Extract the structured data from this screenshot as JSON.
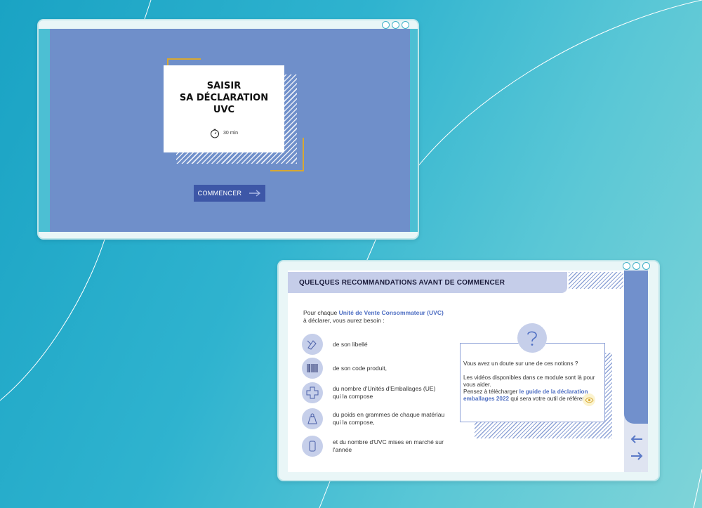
{
  "window1": {
    "title_lines": [
      "SAISIR",
      "SA DÉCLARATION",
      "UVC"
    ],
    "duration": "30 min",
    "start_label": "COMMENCER"
  },
  "window2": {
    "header": "QUELQUES RECOMMANDATIONS AVANT DE COMMENCER",
    "intro": {
      "pre": "Pour chaque ",
      "highlight": "Unité de Vente Consommateur (UVC)",
      "post": " à déclarer, vous aurez besoin :"
    },
    "items": [
      {
        "icon": "pen-tag-icon",
        "text": "de son libellé"
      },
      {
        "icon": "barcode-icon",
        "text": "de son code produit,"
      },
      {
        "icon": "boxes-icon",
        "text": "du nombre d'Unités d'Emballages (UE) qui la compose"
      },
      {
        "icon": "weight-icon",
        "text": "du poids en grammes de chaque matériau qui la compose,"
      },
      {
        "icon": "can-icon",
        "text": "et du nombre d'UVC mises en marché sur l'année"
      }
    ],
    "info": {
      "question": "Vous avez un doute sur une de ces notions ?",
      "videos": "Les vidéos disponibles dans ce module sont là pour vous aider.",
      "download_pre": "Pensez à télécharger ",
      "download_link": "le guide de la déclaration emballages 2022",
      "download_post": " qui sera votre outil de référence."
    }
  },
  "colors": {
    "slide_bg": "#6f8fca",
    "button": "#3d57a7",
    "accent_gold": "#d7a832",
    "highlight": "#4f6fc3"
  }
}
